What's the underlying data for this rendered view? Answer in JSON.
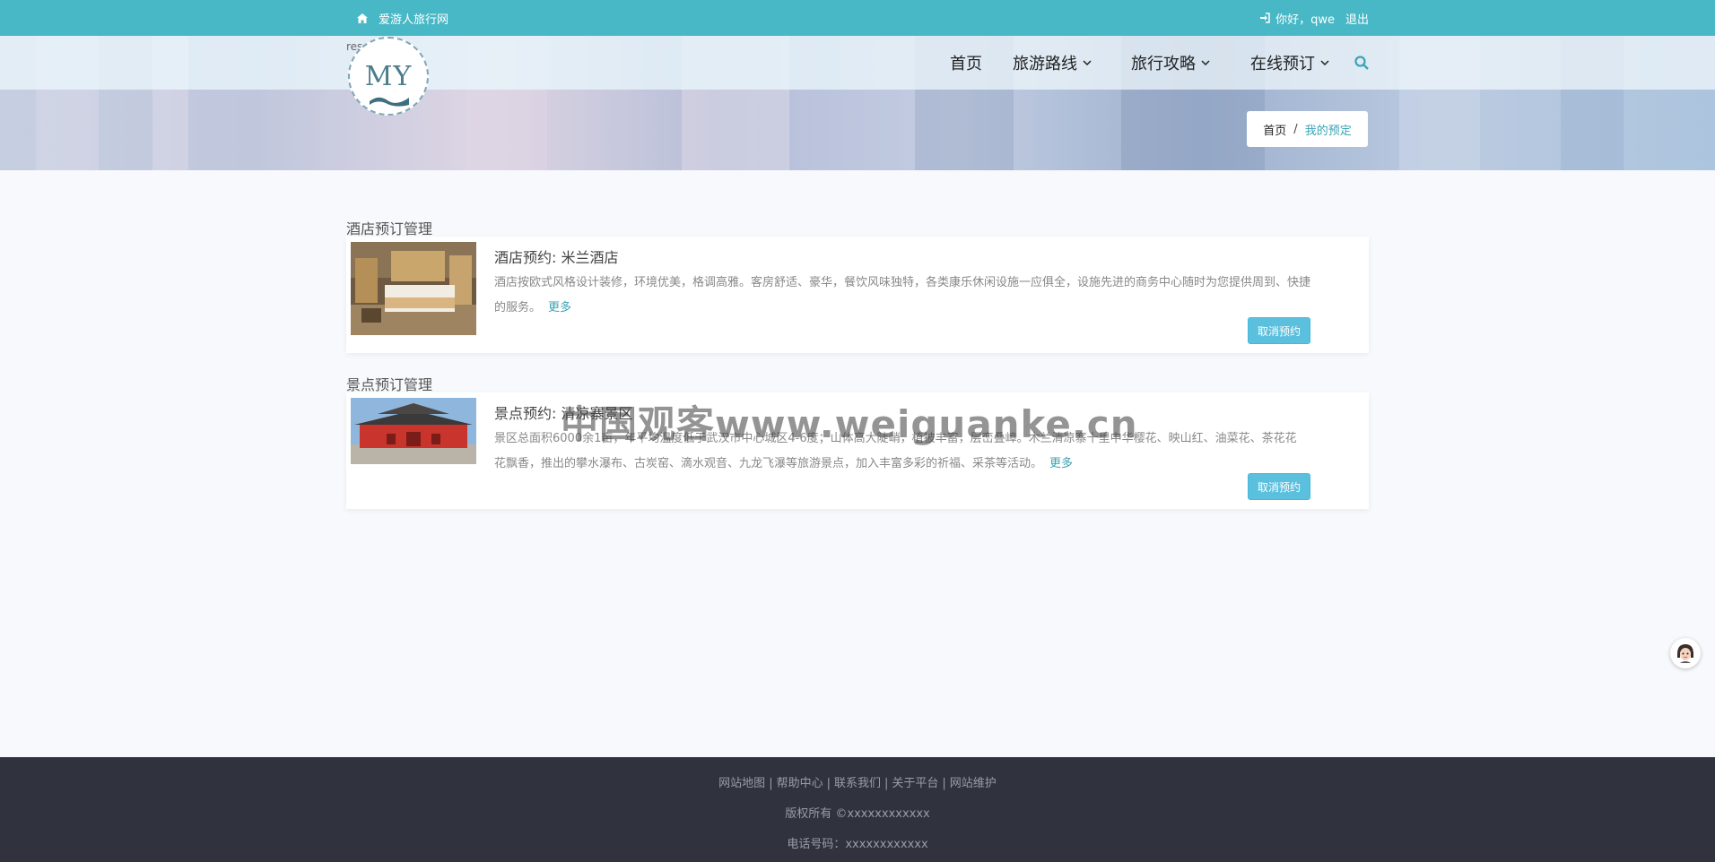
{
  "topbar": {
    "site_name": "爱游人旅行网",
    "greeting": "你好，qwe",
    "logout": "退出"
  },
  "logo": {
    "alt_text": "res",
    "text": "MY"
  },
  "nav": {
    "items": [
      {
        "label": "首页"
      },
      {
        "label": "旅游路线"
      },
      {
        "label": "旅行攻略"
      },
      {
        "label": "在线预订"
      }
    ]
  },
  "breadcrumb": {
    "home": "首页",
    "separator": "/",
    "current": "我的预定"
  },
  "hotel_section": {
    "title": "酒店预订管理",
    "card": {
      "title": "酒店预约: 米兰酒店",
      "description": "酒店按欧式风格设计装修，环境优美，格调高雅。客房舒适、豪华，餐饮风味独特，各类康乐休闲设施一应俱全，设施先进的商务中心随时为您提供周到、快捷的服务。",
      "more": "更多",
      "cancel": "取消预约"
    }
  },
  "scenic_section": {
    "title": "景点预订管理",
    "card": {
      "title": "景点预约: 清凉寨景区",
      "description": "景区总面积6000余1亩，年平均温度低于武汉市中心城区4-6度；山体高大陡峭，植被丰富，层峦叠嶂。木兰清凉寨十里中华樱花、映山红、油菜花、茶花花花飘香，推出的攀水瀑布、古炭窑、滴水观音、九龙飞瀑等旅游景点，加入丰富多彩的祈福、采茶等活动。",
      "more": "更多",
      "cancel": "取消预约"
    }
  },
  "watermark": "中国观客www.weiguanke.cn",
  "footer": {
    "links": [
      "网站地图",
      "帮助中心",
      "联系我们",
      "关于平台",
      "网站维护"
    ],
    "link_separator": "|",
    "copyright": "版权所有 ©xxxxxxxxxxxx",
    "phone": "电话号码：xxxxxxxxxxxx"
  },
  "colors": {
    "accent": "#48b8c6",
    "link": "#3aa3b5",
    "button": "#5bc0de",
    "footer_bg": "#30323e"
  },
  "icons": {
    "home": "home-icon",
    "login": "sign-in-icon",
    "search": "search-icon",
    "chevron": "chevron-down-icon"
  }
}
